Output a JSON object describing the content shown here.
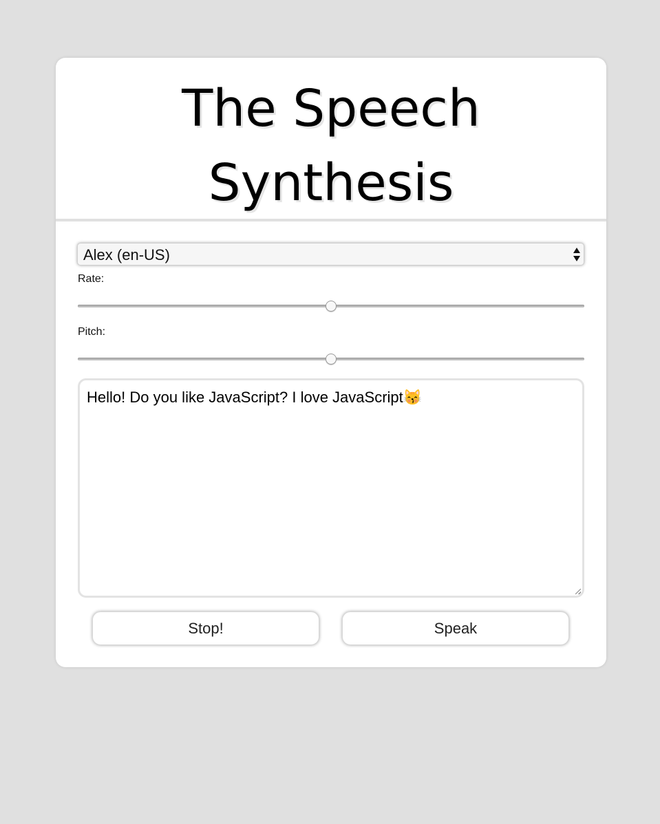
{
  "header": {
    "title_line1": "The Speech",
    "title_line2": "Synthesis"
  },
  "voice_select": {
    "selected": "Alex (en-US)"
  },
  "rate": {
    "label": "Rate:",
    "value": 1,
    "min": 0,
    "max": 3,
    "fraction": 0.5
  },
  "pitch": {
    "label": "Pitch:",
    "value": 1,
    "min": 0,
    "max": 2,
    "fraction": 0.5
  },
  "message": {
    "text": "Hello! Do you like JavaScript? I love JavaScript😽"
  },
  "buttons": {
    "stop_label": "Stop!",
    "speak_label": "Speak"
  },
  "colors": {
    "page_background": "#e0e0e0",
    "card_background": "#ffffff",
    "border": "#e3e3e3"
  }
}
